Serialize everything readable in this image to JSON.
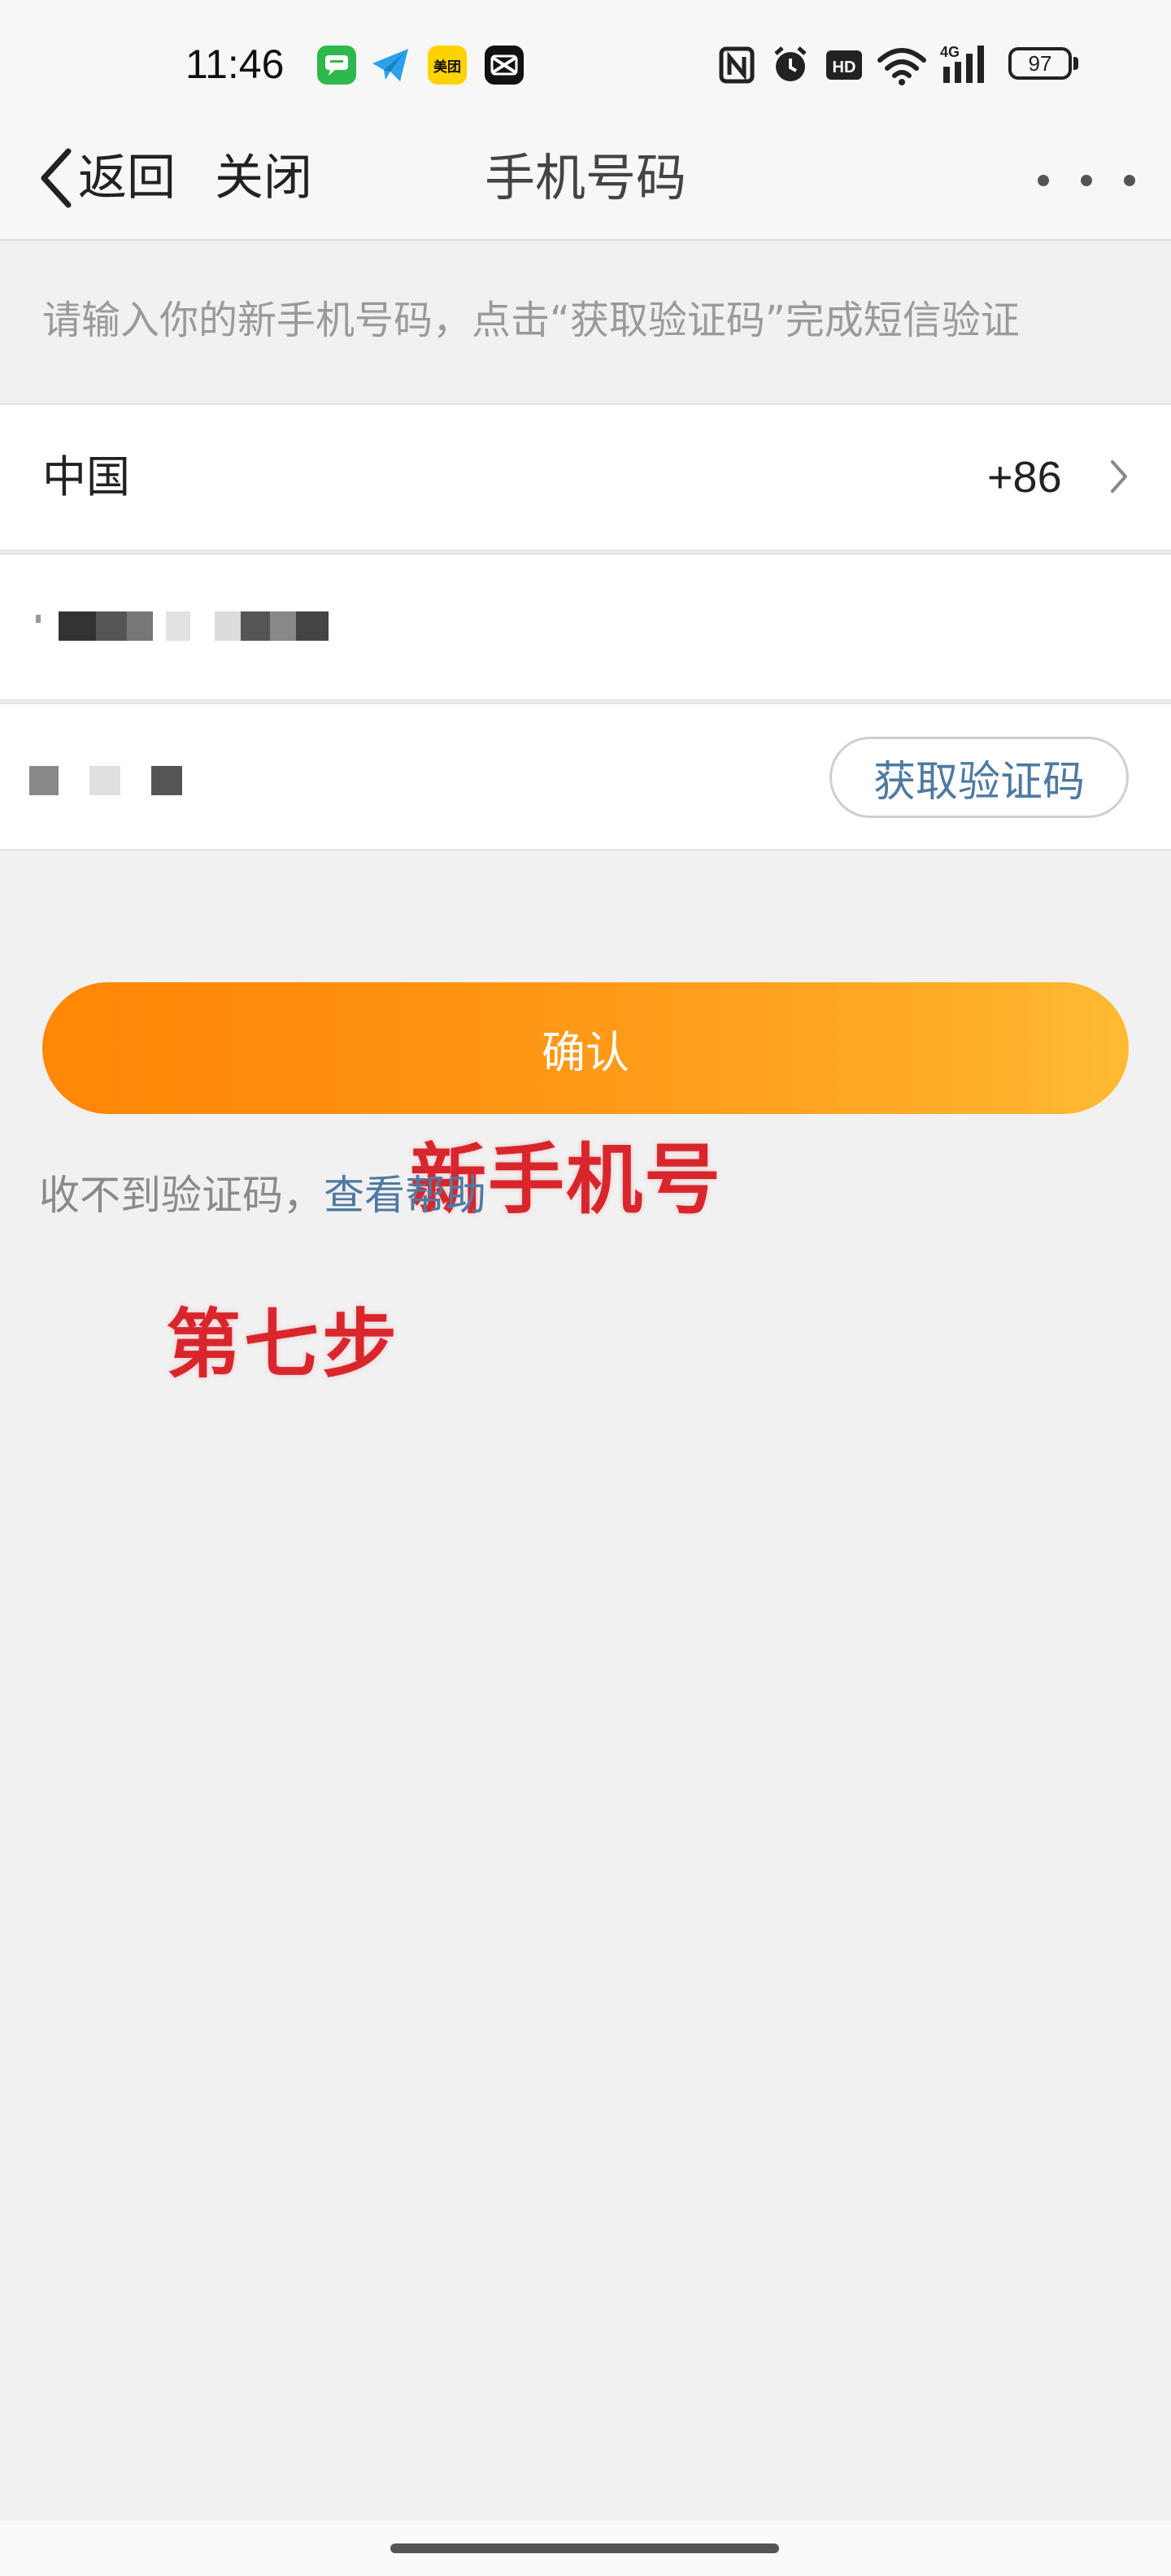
{
  "status_bar": {
    "time": "11:46",
    "apps": [
      "messages-icon",
      "telegram-icon",
      "meituan-icon",
      "capcut-icon"
    ],
    "meituan_label": "美团",
    "indicators": [
      "nfc-icon",
      "alarm-icon",
      "hd-icon",
      "wifi-icon",
      "signal-4g-icon"
    ],
    "hd_label": "HD",
    "network_label": "4G",
    "battery": "97"
  },
  "nav": {
    "back_label": "返回",
    "close_label": "关闭",
    "title": "手机号码",
    "more_icon": "more-dots-icon"
  },
  "hint": "请输入你的新手机号码，点击“获取验证码”完成短信验证",
  "form": {
    "country": "中国",
    "country_code": "+86",
    "get_code_label": "获取验证码"
  },
  "annotations": {
    "new_phone": "新手机号",
    "step": "第七步"
  },
  "confirm_label": "确认",
  "help": {
    "prefix": "收不到验证码，",
    "link": "查看帮助"
  },
  "colors": {
    "accent_orange_start": "#ff8806",
    "accent_orange_end": "#ffba33",
    "link_blue": "#4e79a2",
    "annotation_red": "#d8262c",
    "background": "#f1f1f1"
  }
}
